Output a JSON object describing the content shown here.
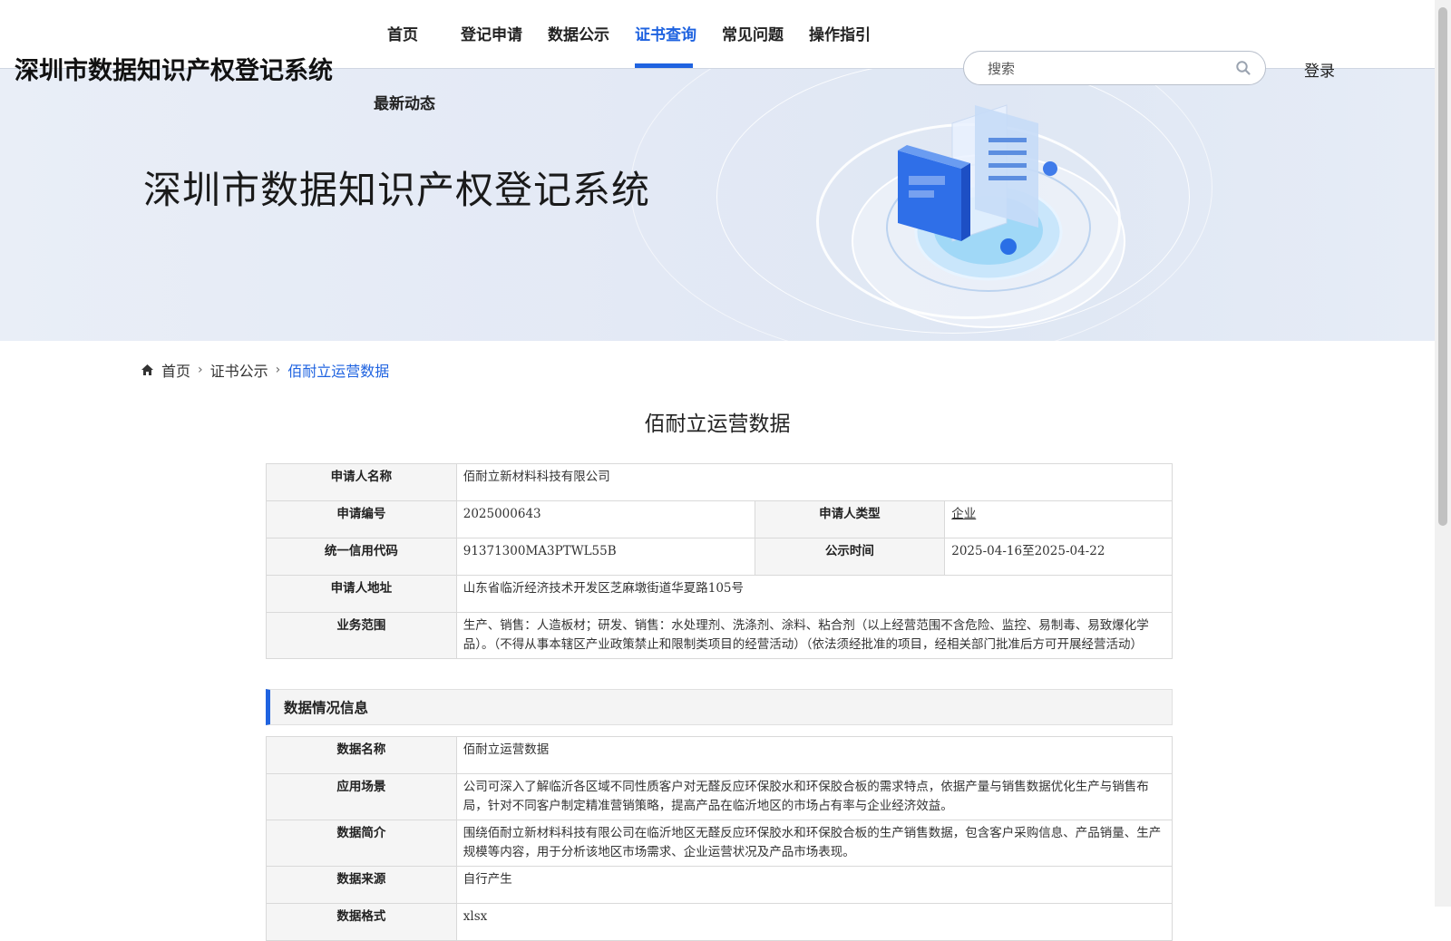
{
  "site": {
    "title": "深圳市数据知识产权登记系统",
    "hero_title": "深圳市数据知识产权登记系统"
  },
  "nav": {
    "items": [
      {
        "label": "首页"
      },
      {
        "label": "登记申请"
      },
      {
        "label": "数据公示"
      },
      {
        "label": "证书查询",
        "active": true
      },
      {
        "label": "常见问题"
      },
      {
        "label": "操作指引"
      },
      {
        "label": "最新动态"
      }
    ],
    "accent": "#1f63e0"
  },
  "search": {
    "placeholder": "搜索",
    "value": ""
  },
  "login_label": "登录",
  "breadcrumb": {
    "home": "首页",
    "parent": "证书公示",
    "current": "佰耐立运营数据"
  },
  "page_title": "佰耐立运营数据",
  "applicant": {
    "name_label": "申请人名称",
    "name": "佰耐立新材料科技有限公司",
    "no_label": "申请编号",
    "no": "2025000643",
    "type_label": "申请人类型",
    "type": "企业",
    "credit_label": "统一信用代码",
    "credit": "91371300MA3PTWL55B",
    "publish_label": "公示时间",
    "publish": "2025-04-16至2025-04-22",
    "address_label": "申请人地址",
    "address": "山东省临沂经济技术开发区芝麻墩街道华夏路105号",
    "scope_label": "业务范围",
    "scope": "生产、销售：人造板材；研发、销售：水处理剂、洗涤剂、涂料、粘合剂（以上经营范围不含危险、监控、易制毒、易致爆化学品）。（不得从事本辖区产业政策禁止和限制类项目的经营活动）（依法须经批准的项目，经相关部门批准后方可开展经营活动）"
  },
  "data_section": {
    "heading": "数据情况信息",
    "name_label": "数据名称",
    "name": "佰耐立运营数据",
    "scene_label": "应用场景",
    "scene": "公司可深入了解临沂各区域不同性质客户对无醛反应环保胶水和环保胶合板的需求特点，依据产量与销售数据优化生产与销售布局，针对不同客户制定精准营销策略，提高产品在临沂地区的市场占有率与企业经济效益。",
    "intro_label": "数据简介",
    "intro": "围绕佰耐立新材料科技有限公司在临沂地区无醛反应环保胶水和环保胶合板的生产销售数据，包含客户采购信息、产品销量、生产规模等内容，用于分析该地区市场需求、企业运营状况及产品市场表现。",
    "source_label": "数据来源",
    "source": "自行产生",
    "format_label": "数据格式",
    "format": "xlsx"
  }
}
